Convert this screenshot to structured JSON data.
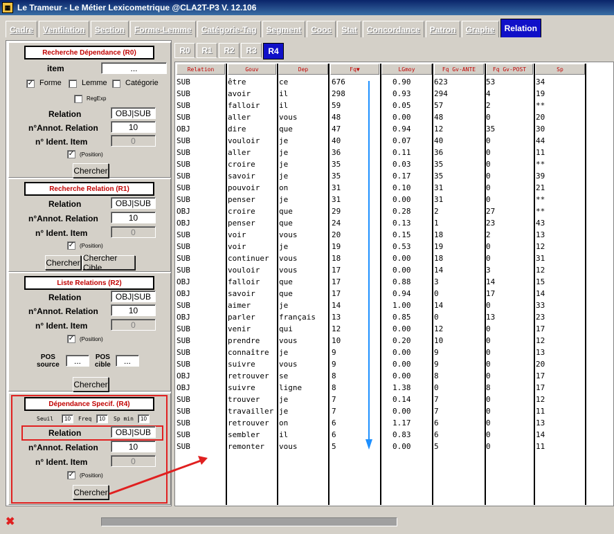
{
  "window": {
    "title": "Le Trameur - Le Métier Lexicometrique @CLA2T-P3 V. 12.106",
    "icon": "app-icon"
  },
  "main_tabs": [
    {
      "label": "Cadre"
    },
    {
      "label": "Ventilation"
    },
    {
      "label": "Section"
    },
    {
      "label": "Forme-Lemme"
    },
    {
      "label": "Catégorie-Tag"
    },
    {
      "label": "Segment"
    },
    {
      "label": "Cooc"
    },
    {
      "label": "Stat"
    },
    {
      "label": "Concordance"
    },
    {
      "label": "Patron"
    },
    {
      "label": "Graphe"
    },
    {
      "label": "Relation",
      "active": true
    }
  ],
  "r0": {
    "title": "Recherche Dépendance (R0)",
    "item_label": "item",
    "item_value": "...",
    "forme_label": "Forme",
    "forme_checked": true,
    "lemme_label": "Lemme",
    "lemme_checked": false,
    "categorie_label": "Catégorie",
    "categorie_checked": false,
    "regexp_label": "RegExp",
    "regexp_checked": false,
    "relation_label": "Relation",
    "relation_value": "OBJ|SUB",
    "annot_label": "n°Annot. Relation",
    "annot_value": "10",
    "ident_label": "n° Ident. Item",
    "ident_value": "0",
    "position_label": "(Position)",
    "position_checked": true,
    "search_label": "Chercher"
  },
  "r1": {
    "title": "Recherche Relation (R1)",
    "relation_label": "Relation",
    "relation_value": "OBJ|SUB",
    "annot_label": "n°Annot. Relation",
    "annot_value": "10",
    "ident_label": "n° Ident. Item",
    "ident_value": "0",
    "position_label": "(Position)",
    "position_checked": true,
    "search_label": "Chercher",
    "search_target_label": "Chercher Cible"
  },
  "r2": {
    "title": "Liste Relations (R2)",
    "relation_label": "Relation",
    "relation_value": "OBJ|SUB",
    "annot_label": "n°Annot. Relation",
    "annot_value": "10",
    "ident_label": "n° Ident. Item",
    "ident_value": "0",
    "position_label": "(Position)",
    "position_checked": true,
    "pos_source_label_1": "POS",
    "pos_source_label_2": "source",
    "pos_source_value": "...",
    "pos_cible_label_1": "POS",
    "pos_cible_label_2": "cible",
    "pos_cible_value": "...",
    "search_label": "Chercher"
  },
  "r4": {
    "title": "Dépendance Specif. (R4)",
    "seuil_label": "Seuil",
    "seuil_value": "10",
    "freq_label": "Freq",
    "freq_value": "10",
    "spmin_label": "Sp min",
    "spmin_value": "10",
    "relation_label": "Relation",
    "relation_value": "OBJ|SUB",
    "annot_label": "n°Annot. Relation",
    "annot_value": "10",
    "ident_label": "n° Ident. Item",
    "ident_value": "0",
    "position_label": "(Position)",
    "position_checked": true,
    "search_label": "Chercher"
  },
  "sub_tabs": [
    {
      "label": "R0"
    },
    {
      "label": "R1"
    },
    {
      "label": "R2"
    },
    {
      "label": "R3"
    },
    {
      "label": "R4",
      "active": true
    }
  ],
  "table": {
    "headers": [
      "Relation",
      "Gouv",
      "Dep",
      "Fq",
      "LGmoy",
      "Fq Gv-ANTE",
      "Fq Gv-POST",
      "Sp"
    ],
    "sort_indicator": "▼",
    "rows": [
      [
        "SUB",
        "être",
        "ce",
        "676",
        "0.90",
        "623",
        "53",
        "34"
      ],
      [
        "SUB",
        "avoir",
        "il",
        "298",
        "0.93",
        "294",
        "4",
        "19"
      ],
      [
        "SUB",
        "falloir",
        "il",
        "59",
        "0.05",
        "57",
        "2",
        "**"
      ],
      [
        "SUB",
        "aller",
        "vous",
        "48",
        "0.00",
        "48",
        "0",
        "20"
      ],
      [
        "OBJ",
        "dire",
        "que",
        "47",
        "0.94",
        "12",
        "35",
        "30"
      ],
      [
        "SUB",
        "vouloir",
        "je",
        "40",
        "0.07",
        "40",
        "0",
        "44"
      ],
      [
        "SUB",
        "aller",
        "je",
        "36",
        "0.11",
        "36",
        "0",
        "11"
      ],
      [
        "SUB",
        "croire",
        "je",
        "35",
        "0.03",
        "35",
        "0",
        "**"
      ],
      [
        "SUB",
        "savoir",
        "je",
        "35",
        "0.17",
        "35",
        "0",
        "39"
      ],
      [
        "SUB",
        "pouvoir",
        "on",
        "31",
        "0.10",
        "31",
        "0",
        "21"
      ],
      [
        "SUB",
        "penser",
        "je",
        "31",
        "0.00",
        "31",
        "0",
        "**"
      ],
      [
        "OBJ",
        "croire",
        "que",
        "29",
        "0.28",
        "2",
        "27",
        "**"
      ],
      [
        "OBJ",
        "penser",
        "que",
        "24",
        "0.13",
        "1",
        "23",
        "43"
      ],
      [
        "SUB",
        "voir",
        "vous",
        "20",
        "0.15",
        "18",
        "2",
        "13"
      ],
      [
        "SUB",
        "voir",
        "je",
        "19",
        "0.53",
        "19",
        "0",
        "12"
      ],
      [
        "SUB",
        "continuer",
        "vous",
        "18",
        "0.00",
        "18",
        "0",
        "31"
      ],
      [
        "SUB",
        "vouloir",
        "vous",
        "17",
        "0.00",
        "14",
        "3",
        "12"
      ],
      [
        "OBJ",
        "falloir",
        "que",
        "17",
        "0.88",
        "3",
        "14",
        "15"
      ],
      [
        "OBJ",
        "savoir",
        "que",
        "17",
        "0.94",
        "0",
        "17",
        "14"
      ],
      [
        "SUB",
        "aimer",
        "je",
        "14",
        "1.00",
        "14",
        "0",
        "33"
      ],
      [
        "OBJ",
        "parler",
        "français",
        "13",
        "0.85",
        "0",
        "13",
        "23"
      ],
      [
        "SUB",
        "venir",
        "qui",
        "12",
        "0.00",
        "12",
        "0",
        "17"
      ],
      [
        "SUB",
        "prendre",
        "vous",
        "10",
        "0.20",
        "10",
        "0",
        "12"
      ],
      [
        "SUB",
        "connaître",
        "je",
        "9",
        "0.00",
        "9",
        "0",
        "13"
      ],
      [
        "SUB",
        "suivre",
        "vous",
        "9",
        "0.00",
        "9",
        "0",
        "20"
      ],
      [
        "OBJ",
        "retrouver",
        "se",
        "8",
        "0.00",
        "8",
        "0",
        "17"
      ],
      [
        "OBJ",
        "suivre",
        "ligne",
        "8",
        "1.38",
        "0",
        "8",
        "17"
      ],
      [
        "SUB",
        "trouver",
        "je",
        "7",
        "0.14",
        "7",
        "0",
        "12"
      ],
      [
        "SUB",
        "travailler",
        "je",
        "7",
        "0.00",
        "7",
        "0",
        "11"
      ],
      [
        "SUB",
        "retrouver",
        "on",
        "6",
        "1.17",
        "6",
        "0",
        "13"
      ],
      [
        "SUB",
        "sembler",
        "il",
        "6",
        "0.83",
        "6",
        "0",
        "14"
      ],
      [
        "SUB",
        "remonter",
        "vous",
        "5",
        "0.00",
        "5",
        "0",
        "11"
      ]
    ]
  },
  "status": {
    "error_icon": "close-icon"
  },
  "colors": {
    "accent": "#1010c8",
    "title_red": "#c00000",
    "highlight_red": "#e02020",
    "arrow_blue": "#1e90ff"
  }
}
